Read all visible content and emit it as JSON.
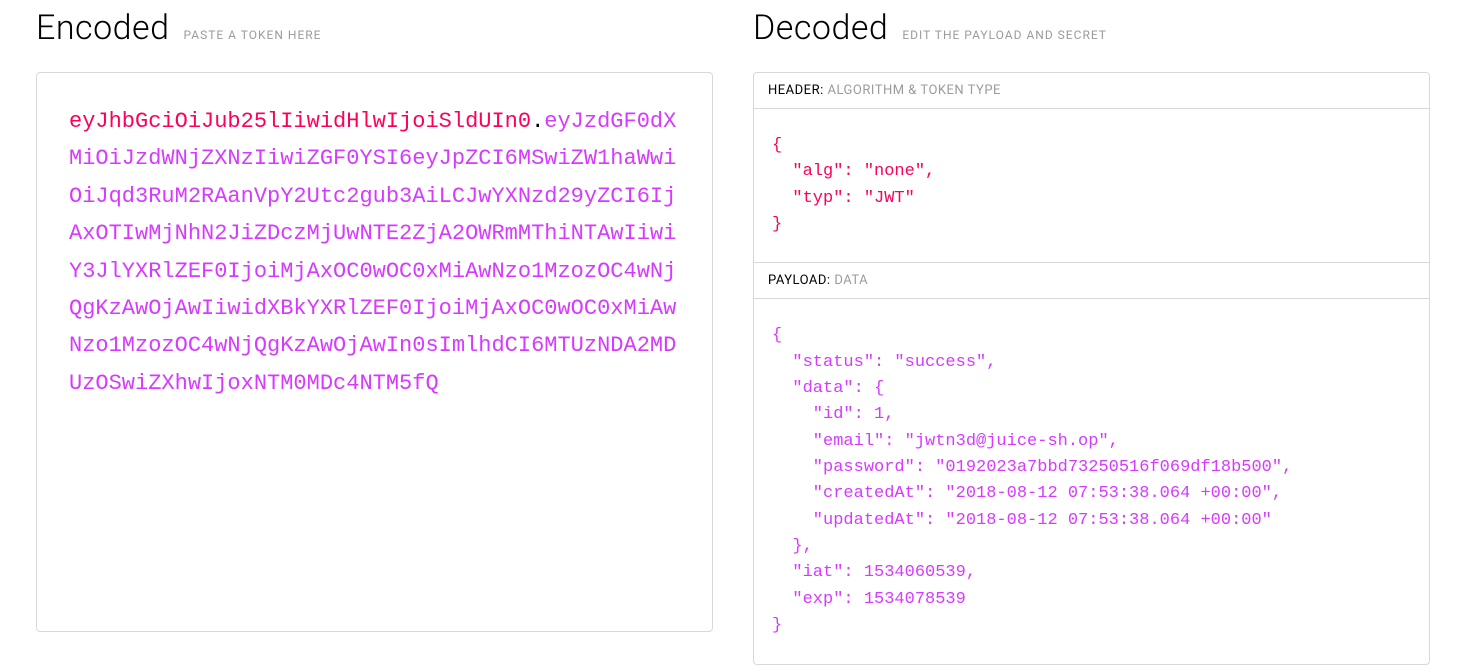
{
  "encoded": {
    "title": "Encoded",
    "subtitle": "PASTE A TOKEN HERE",
    "tokenHeader": "eyJhbGciOiJub25lIiwidHlwIjoiSldUIn0",
    "tokenPayload": "eyJzdGF0dXMiOiJzdWNjZXNzIiwiZGF0YSI6eyJpZCI6MSwiZW1haWwiOiJqd3RuM2RAanVpY2Utc2gub3AiLCJwYXNzd29yZCI6IjAxOTIwMjNhN2JiZDczMjUwNTE2ZjA2OWRmMThiNTAwIiwiY3JlYXRlZEF0IjoiMjAxOC0wOC0xMiAwNzo1MzozOC4wNjQgKzAwOjAwIiwidXBkYXRlZEF0IjoiMjAxOC0wOC0xMiAwNzo1MzozOC4wNjQgKzAwOjAwIn0sImlhdCI6MTUzNDA2MDUzOSwiZXhwIjoxNTM0MDc4NTM5fQ"
  },
  "decoded": {
    "title": "Decoded",
    "subtitle": "EDIT THE PAYLOAD AND SECRET",
    "headerSection": {
      "labelPrimary": "HEADER:",
      "labelSecondary": "ALGORITHM & TOKEN TYPE",
      "content": "{\n  \"alg\": \"none\",\n  \"typ\": \"JWT\"\n}"
    },
    "payloadSection": {
      "labelPrimary": "PAYLOAD:",
      "labelSecondary": "DATA",
      "content": "{\n  \"status\": \"success\",\n  \"data\": {\n    \"id\": 1,\n    \"email\": \"jwtn3d@juice-sh.op\",\n    \"password\": \"0192023a7bbd73250516f069df18b500\",\n    \"createdAt\": \"2018-08-12 07:53:38.064 +00:00\",\n    \"updatedAt\": \"2018-08-12 07:53:38.064 +00:00\"\n  },\n  \"iat\": 1534060539,\n  \"exp\": 1534078539\n}"
    }
  }
}
